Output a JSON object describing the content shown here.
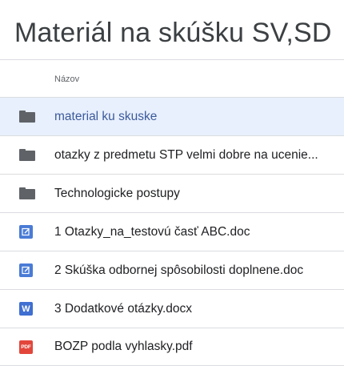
{
  "page_title": "Materiál na skúšku SV,SD",
  "column_header": "Názov",
  "colors": {
    "selected_background": "#e8f0fe",
    "selected_text": "#3c5a9a",
    "folder_icon": "#5f6368",
    "doc_icon": "#4a7bd6",
    "word_icon": "#3f6fd1",
    "pdf_icon": "#e2463b"
  },
  "files": [
    {
      "name": "material ku skuske",
      "icon": "folder-icon",
      "selected": true
    },
    {
      "name": "otazky z predmetu STP velmi dobre na ucenie...",
      "icon": "folder-icon",
      "selected": false
    },
    {
      "name": "Technologicke postupy",
      "icon": "folder-icon",
      "selected": false
    },
    {
      "name": "1 Otazky_na_testovú časť ABC.doc",
      "icon": "doc-icon",
      "selected": false
    },
    {
      "name": "2 Skúška odbornej spôsobilosti doplnene.doc",
      "icon": "doc-icon",
      "selected": false
    },
    {
      "name": "3 Dodatkové otázky.docx",
      "icon": "word-icon",
      "icon_text": "W",
      "selected": false
    },
    {
      "name": "BOZP podla vyhlasky.pdf",
      "icon": "pdf-icon",
      "icon_text": "PDF",
      "selected": false
    }
  ]
}
